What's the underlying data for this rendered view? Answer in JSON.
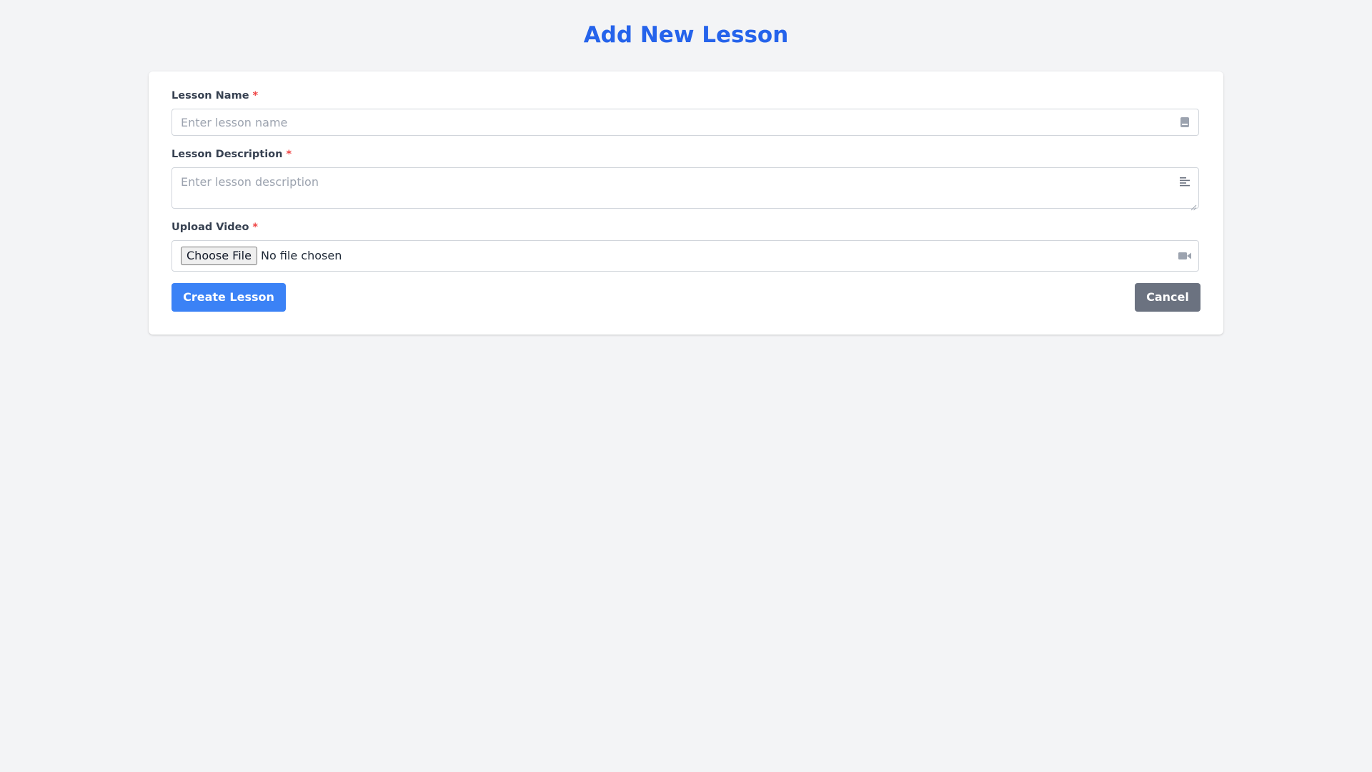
{
  "page": {
    "title": "Add New Lesson"
  },
  "form": {
    "lesson_name": {
      "label": "Lesson Name",
      "required_mark": "*",
      "placeholder": "Enter lesson name",
      "value": "",
      "icon": "book-icon"
    },
    "lesson_description": {
      "label": "Lesson Description",
      "required_mark": "*",
      "placeholder": "Enter lesson description",
      "value": "",
      "icon": "align-left-icon"
    },
    "upload_video": {
      "label": "Upload Video",
      "required_mark": "*",
      "button_label": "Choose File",
      "status": "No file chosen",
      "icon": "video-camera-icon"
    }
  },
  "actions": {
    "create_label": "Create Lesson",
    "cancel_label": "Cancel"
  },
  "colors": {
    "title": "#2563eb",
    "primary_button": "#3b82f6",
    "secondary_button": "#6b7280",
    "required": "#ef4444",
    "background": "#f3f4f6"
  }
}
